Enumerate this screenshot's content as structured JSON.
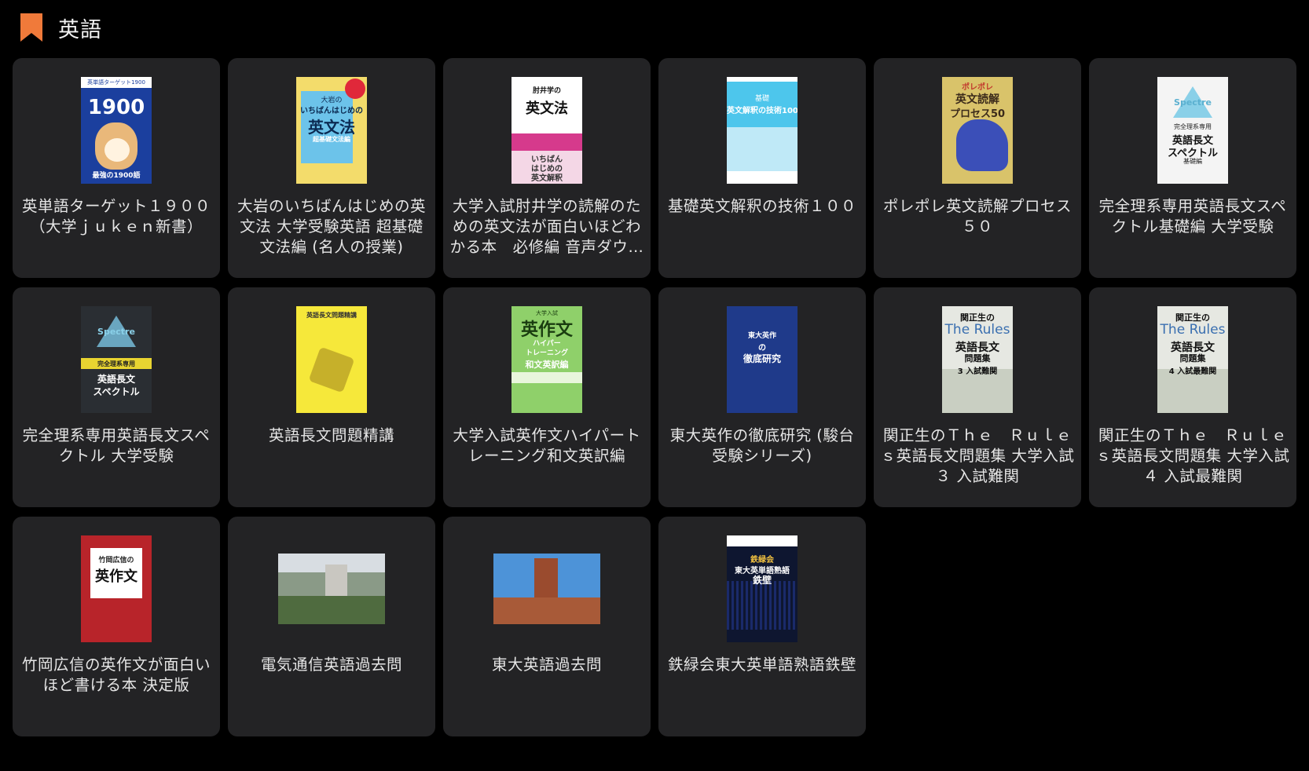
{
  "section": {
    "title": "英語",
    "icon": "bookmark-icon",
    "accent_color": "#f07a3a"
  },
  "books": [
    {
      "title": "英単語ターゲット１９００（大学ｊｕｋｅｎ新書）",
      "cover": "cv-target",
      "cover_lines": [
        "英単語ターゲット1900",
        "1900",
        "最強の1900語"
      ]
    },
    {
      "title": "大岩のいちばんはじめの英文法 大学受験英語 超基礎文法編 (名人の授業)",
      "cover": "cv-oiwa",
      "cover_lines": [
        "大岩の",
        "いちばんはじめの",
        "英文法",
        "超基礎文法編"
      ]
    },
    {
      "title": "大学入試肘井学の読解のための英文法が面白いほどわかる本　必修編 音声ダウンロード付",
      "cover": "cv-kokii",
      "cover_lines": [
        "肘井学の",
        "英文法",
        "いちばん",
        "はじめの",
        "英文解釈"
      ]
    },
    {
      "title": "基礎英文解釈の技術１００",
      "cover": "cv-kiso",
      "cover_lines": [
        "基礎",
        "英文解釈の技術100"
      ]
    },
    {
      "title": "ポレポレ英文読解プロセス５０",
      "cover": "cv-pore",
      "cover_lines": [
        "ポレポレ",
        "英文読解",
        "プロセス50"
      ]
    },
    {
      "title": "完全理系専用英語長文スペクトル基礎編 大学受験",
      "cover": "cv-spec1",
      "cover_lines": [
        "Spectre",
        "完全理系専用",
        "英語長文",
        "スペクトル",
        "基礎編"
      ]
    },
    {
      "title": "完全理系専用英語長文スペクトル 大学受験",
      "cover": "cv-spec2",
      "cover_lines": [
        "Spectre",
        "完全理系専用",
        "英語長文",
        "スペクトル"
      ]
    },
    {
      "title": "英語長文問題精講",
      "cover": "cv-seikou",
      "cover_lines": [
        "英語長文問題精講"
      ]
    },
    {
      "title": "大学入試英作文ハイパートレーニング和文英訳編",
      "cover": "cv-hyper",
      "cover_lines": [
        "大学入試",
        "英作文",
        "ハイパー",
        "トレーニング",
        "和文英訳編"
      ]
    },
    {
      "title": "東大英作の徹底研究 (駿台受験シリーズ)",
      "cover": "cv-todai",
      "cover_lines": [
        "東大英作",
        "の",
        "徹底研究"
      ]
    },
    {
      "title": "関正生のＴｈｅ　Ｒｕｌｅｓ英語長文問題集 大学入試 ３ 入試難関",
      "cover": "cv-rules",
      "cover_lines": [
        "関正生の",
        "The Rules",
        "英語長文",
        "問題集",
        "3 入試難関"
      ]
    },
    {
      "title": "関正生のＴｈｅ　Ｒｕｌｅｓ英語長文問題集 大学入試 ４ 入試最難関",
      "cover": "cv-rules",
      "cover_lines": [
        "関正生の",
        "The Rules",
        "英語長文",
        "問題集",
        "4 入試最難関"
      ]
    },
    {
      "title": "竹岡広信の英作文が面白いほど書ける本 決定版",
      "cover": "cv-takeoka",
      "cover_lines": [
        "竹岡広信の",
        "英作文"
      ]
    },
    {
      "title": "電気通信英語過去問",
      "cover": "cv-photo1",
      "cover_lines": []
    },
    {
      "title": "東大英語過去問",
      "cover": "cv-photo2",
      "cover_lines": []
    },
    {
      "title": "鉄緑会東大英単語熟語鉄壁",
      "cover": "cv-tekiheki",
      "cover_lines": [
        "鉄緑会",
        "東大英単語熟語",
        "鉄壁"
      ]
    }
  ]
}
